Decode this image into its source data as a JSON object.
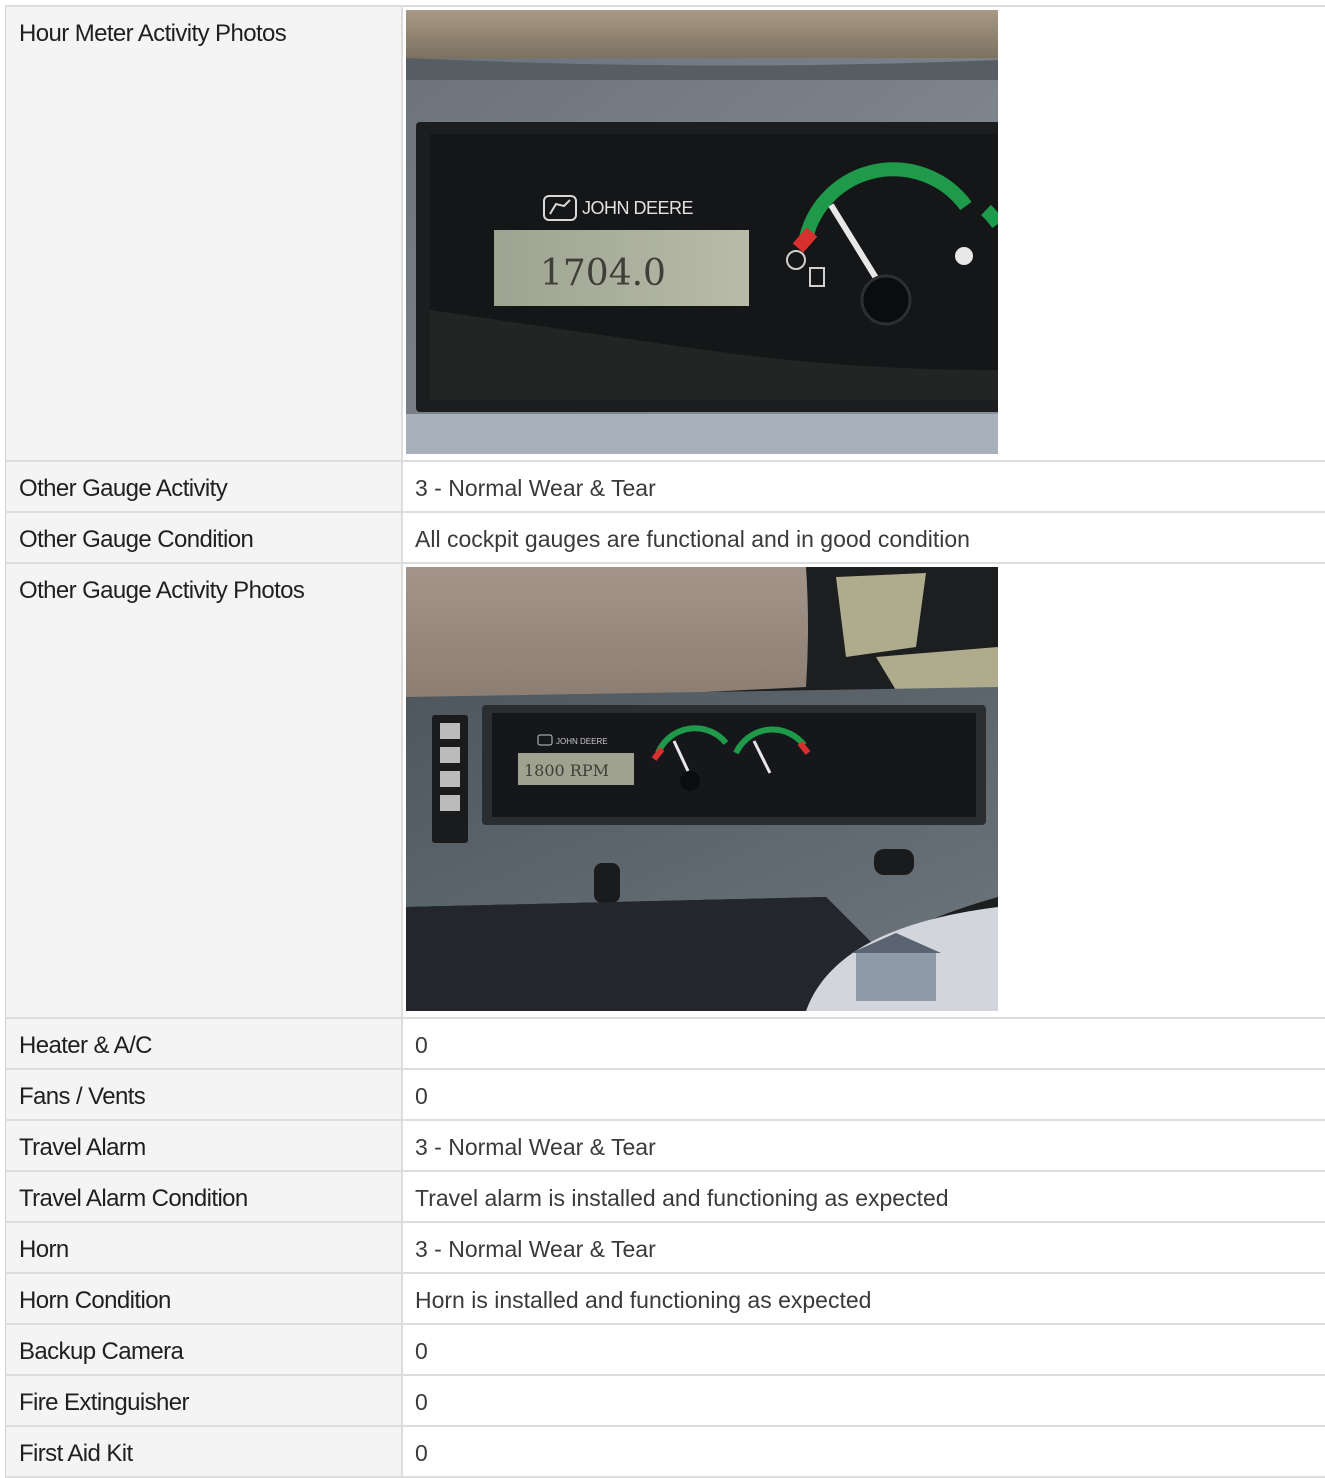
{
  "rows": [
    {
      "label": "Hour Meter Activity Photos",
      "type": "photo",
      "photo": "hour-meter-photo"
    },
    {
      "label": "Other Gauge Activity",
      "value": "3 - Normal Wear & Tear"
    },
    {
      "label": "Other Gauge Condition",
      "value": "All cockpit gauges are functional and in good condition"
    },
    {
      "label": "Other Gauge Activity Photos",
      "type": "photo",
      "photo": "gauge-panel-photo"
    },
    {
      "label": "Heater & A/C",
      "value": "0"
    },
    {
      "label": "Fans / Vents",
      "value": "0"
    },
    {
      "label": "Travel Alarm",
      "value": "3 - Normal Wear & Tear"
    },
    {
      "label": "Travel Alarm Condition",
      "value": "Travel alarm is installed and functioning as expected"
    },
    {
      "label": "Horn",
      "value": "3 - Normal Wear & Tear"
    },
    {
      "label": "Horn Condition",
      "value": "Horn is installed and functioning as expected"
    },
    {
      "label": "Backup Camera",
      "value": "0"
    },
    {
      "label": "Fire Extinguisher",
      "value": "0"
    },
    {
      "label": "First Aid Kit",
      "value": "0"
    }
  ],
  "photos": {
    "hour_meter": {
      "brand": "JOHN DEERE",
      "readout": "1704.0"
    },
    "gauge_panel": {
      "brand": "JOHN DEERE",
      "readout": "1800 RPM"
    }
  }
}
